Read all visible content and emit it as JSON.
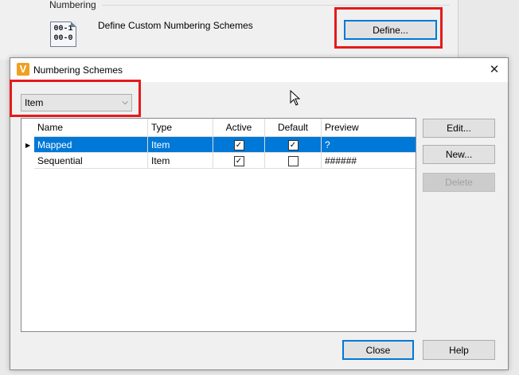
{
  "background": {
    "section_title": "Numbering",
    "icon": {
      "name": "numbering-scheme-icon",
      "line1": "00-1",
      "line2": "00-0"
    },
    "description": "Define Custom Numbering Schemes",
    "define_button": "Define..."
  },
  "dialog": {
    "title": "Numbering Schemes",
    "close_glyph": "✕",
    "app_icon_glyph": "V",
    "scheme_type": {
      "selected": "Item",
      "chevron": "⌵"
    },
    "table": {
      "columns": [
        "Name",
        "Type",
        "Active",
        "Default",
        "Preview"
      ],
      "rows": [
        {
          "name": "Mapped",
          "type": "Item",
          "active": true,
          "default": true,
          "preview": "?",
          "selected": true
        },
        {
          "name": "Sequential",
          "type": "Item",
          "active": true,
          "default": false,
          "preview": "######",
          "selected": false
        }
      ]
    },
    "row_marker_glyph": "▶",
    "check_glyph": "✓",
    "buttons": {
      "edit": "Edit...",
      "new": "New...",
      "delete": "Delete",
      "close": "Close",
      "help": "Help"
    }
  },
  "colors": {
    "highlight_box": "#e41a1c",
    "selection": "#0078d7"
  }
}
